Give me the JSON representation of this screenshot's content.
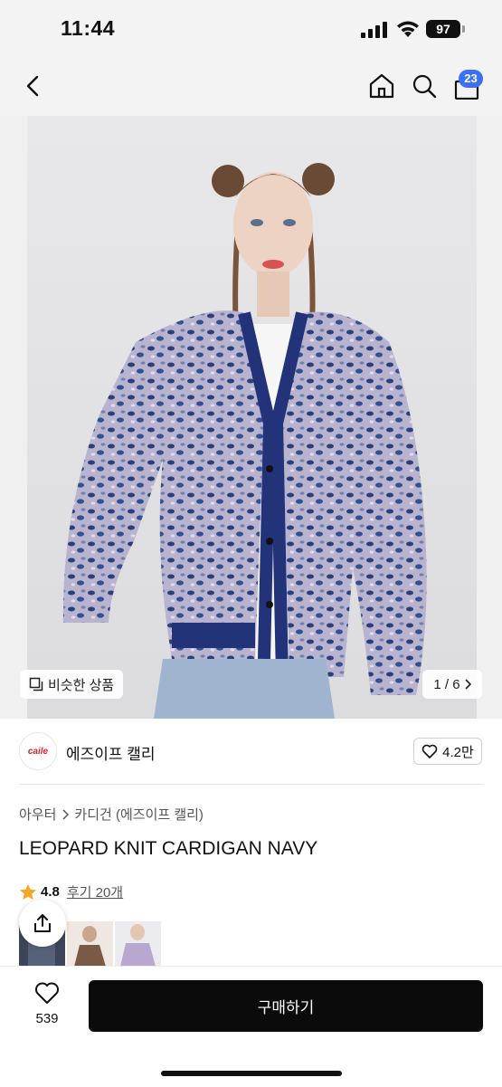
{
  "status_bar": {
    "time": "11:44",
    "battery": "97"
  },
  "nav": {
    "cart_count": "23",
    "icons": [
      "back-chevron-icon",
      "home-icon",
      "search-icon",
      "shopping-bag-icon"
    ]
  },
  "gallery": {
    "similar_label": "비슷한 상품",
    "pager": "1 / 6"
  },
  "brand": {
    "logo_text": "caile",
    "name": "에즈이프 캘리",
    "likes": "4.2만"
  },
  "breadcrumb": {
    "category": "아우터",
    "subcategory": "카디건 (에즈이프 캘리)"
  },
  "product": {
    "title": "LEOPARD KNIT CARDIGAN NAVY",
    "rating": "4.8",
    "reviews_label": "후기 20개"
  },
  "bottom": {
    "wish_count": "539",
    "buy_label": "구매하기"
  },
  "colors": {
    "accent": "#3b6ff5",
    "buy_button": "#0b0b0b",
    "star": "#f5a623",
    "cardigan": "#2b3f7a"
  }
}
